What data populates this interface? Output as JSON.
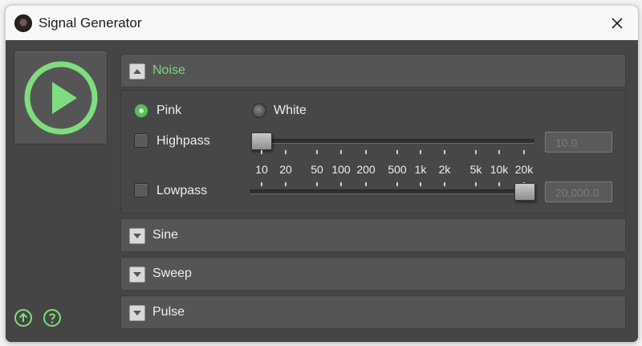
{
  "window": {
    "title": "Signal Generator",
    "close_label": "✕"
  },
  "icons": {
    "app": "app-icon",
    "play": "play-icon",
    "upload": "arrow-up-circle-icon",
    "help": "help-circle-icon",
    "accent_color": "#7fdd7f"
  },
  "sections": {
    "noise": {
      "label": "Noise",
      "expanded": true
    },
    "sine": {
      "label": "Sine",
      "expanded": false
    },
    "sweep": {
      "label": "Sweep",
      "expanded": false
    },
    "pulse": {
      "label": "Pulse",
      "expanded": false
    }
  },
  "noise": {
    "pink_label": "Pink",
    "white_label": "White",
    "selected": "Pink",
    "highpass_label": "Highpass",
    "highpass_enabled": false,
    "highpass_value": "10.0",
    "lowpass_label": "Lowpass",
    "lowpass_enabled": false,
    "lowpass_value": "20,000.0",
    "scale": [
      "10",
      "20",
      "50",
      "100",
      "200",
      "500",
      "1k",
      "2k",
      "5k",
      "10k",
      "20k"
    ]
  }
}
